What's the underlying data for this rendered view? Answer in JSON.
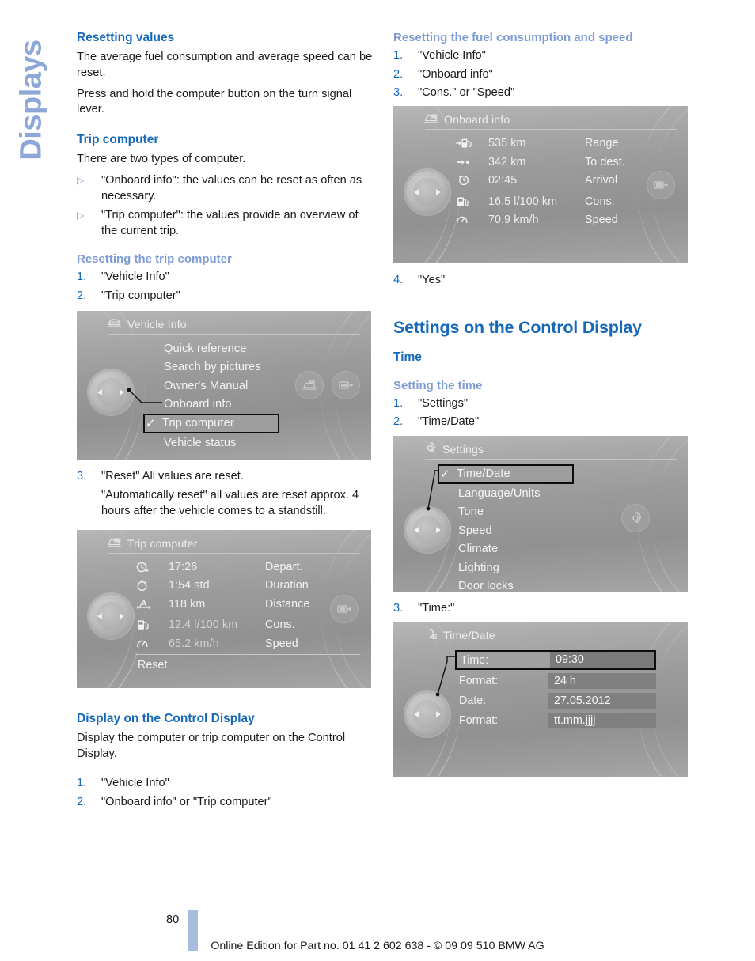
{
  "side_tab": {
    "label": "Displays"
  },
  "left_column": {
    "heading_resetting_values": "Resetting values",
    "para_1": "The average fuel consumption and average speed can be reset.",
    "para_2": "Press and hold the computer button on the turn signal lever.",
    "heading_trip_computer": "Trip computer",
    "para_3": "There are two types of computer.",
    "bullets": [
      "\"Onboard info\": the values can be reset as often as necessary.",
      "\"Trip computer\": the values provide an overview of the current trip."
    ],
    "heading_resetting_trip_computer": "Resetting the trip computer",
    "steps_reset_trip": [
      {
        "num": "1.",
        "text": "\"Vehicle Info\""
      },
      {
        "num": "2.",
        "text": "\"Trip computer\""
      }
    ],
    "step_3": {
      "num": "3.",
      "text": "\"Reset\" All values are reset.",
      "sub": "\"Automatically reset\" all values are reset approx. 4 hours after the vehicle comes to a standstill."
    },
    "heading_display_on_control_display": "Display on the Control Display",
    "para_4": "Display the computer or trip computer on the Control Display.",
    "steps_display": [
      {
        "num": "1.",
        "text": "\"Vehicle Info\""
      },
      {
        "num": "2.",
        "text": "\"Onboard info\" or \"Trip computer\""
      }
    ]
  },
  "right_column": {
    "heading_resetting_fuel": "Resetting the fuel consumption and speed",
    "steps_reset_fuel": [
      {
        "num": "1.",
        "text": "\"Vehicle Info\""
      },
      {
        "num": "2.",
        "text": "\"Onboard info\""
      },
      {
        "num": "3.",
        "text": "\"Cons.\" or \"Speed\""
      }
    ],
    "step_4": {
      "num": "4.",
      "text": "\"Yes\""
    },
    "heading_settings_control_display": "Settings on the Control Display",
    "heading_time": "Time",
    "heading_setting_the_time": "Setting the time",
    "steps_setting_time": [
      {
        "num": "1.",
        "text": "\"Settings\""
      },
      {
        "num": "2.",
        "text": "\"Time/Date\""
      }
    ],
    "step_3_time": {
      "num": "3.",
      "text": "\"Time:\""
    }
  },
  "screens": {
    "vehicle_info": {
      "title": "Vehicle Info",
      "header_icon": "car-front-icon",
      "items": [
        {
          "label": "Quick reference",
          "selected": false
        },
        {
          "label": "Search by pictures",
          "selected": false
        },
        {
          "label": "Owner's Manual",
          "selected": false
        },
        {
          "label": "Onboard info",
          "selected": false
        },
        {
          "label": "Trip computer",
          "selected": true
        },
        {
          "label": "Vehicle status",
          "selected": false
        }
      ],
      "side_icons": [
        "vehicle-icon",
        "display-icon"
      ]
    },
    "trip_computer": {
      "title": "Trip computer",
      "header_icon": "trip-computer-icon",
      "rows": [
        {
          "icon": "departure-clock-icon",
          "value": "17:26",
          "label": "Depart.",
          "dim": false
        },
        {
          "icon": "stopwatch-icon",
          "value": "1:54 std",
          "label": "Duration",
          "dim": false
        },
        {
          "icon": "distance-icon",
          "value": "118 km",
          "label": "Distance",
          "dim": false
        },
        {
          "icon": "fuel-pump-icon",
          "value": "12.4 l/100 km",
          "label": "Cons.",
          "dim": true
        },
        {
          "icon": "speedometer-icon",
          "value": "65.2 km/h",
          "label": "Speed",
          "dim": true
        }
      ],
      "separator_after_index": 2,
      "reset_label": "Reset",
      "side_icons": [
        "display-icon"
      ]
    },
    "onboard_info": {
      "title": "Onboard info",
      "header_icon": "trip-computer-icon",
      "rows": [
        {
          "icon": "range-icon",
          "value": "535 km",
          "label": "Range",
          "dim": false
        },
        {
          "icon": "to-destination-icon",
          "value": "342 km",
          "label": "To dest.",
          "dim": false
        },
        {
          "icon": "arrival-clock-icon",
          "value": "02:45",
          "label": "Arrival",
          "dim": false
        },
        {
          "icon": "fuel-pump-icon",
          "value": "16.5 l/100 km",
          "label": "Cons.",
          "dim": false
        },
        {
          "icon": "speedometer-icon",
          "value": "70.9 km/h",
          "label": "Speed",
          "dim": false
        }
      ],
      "separator_after_index": 2,
      "side_icons": [
        "display-icon"
      ]
    },
    "settings": {
      "title": "Settings",
      "header_icon": "gear-icon",
      "items": [
        {
          "label": "Time/Date",
          "selected": true
        },
        {
          "label": "Language/Units",
          "selected": false
        },
        {
          "label": "Tone",
          "selected": false
        },
        {
          "label": "Speed",
          "selected": false
        },
        {
          "label": "Climate",
          "selected": false
        },
        {
          "label": "Lighting",
          "selected": false
        },
        {
          "label": "Door locks",
          "selected": false
        }
      ],
      "side_icons": [
        "gear-icon"
      ]
    },
    "time_date": {
      "title": "Time/Date",
      "header_icon": "time-date-gear-icon",
      "rows": [
        {
          "label": "Time:",
          "value": "09:30",
          "selected": true
        },
        {
          "label": "Format:",
          "value": "24 h",
          "selected": false
        },
        {
          "label": "Date:",
          "value": "27.05.2012",
          "selected": false
        },
        {
          "label": "Format:",
          "value": "tt.mm.jjjj",
          "selected": false
        }
      ]
    }
  },
  "footer": {
    "page_number": "80",
    "imprint": "Online Edition for Part no. 01 41 2 602 638 - © 09 09 510 BMW AG"
  },
  "colors": {
    "heading_major": "#1668b8",
    "heading_sub": "#7d9bd4",
    "side_tab": "#8da8d8",
    "page_bar": "#a8bcdf"
  }
}
